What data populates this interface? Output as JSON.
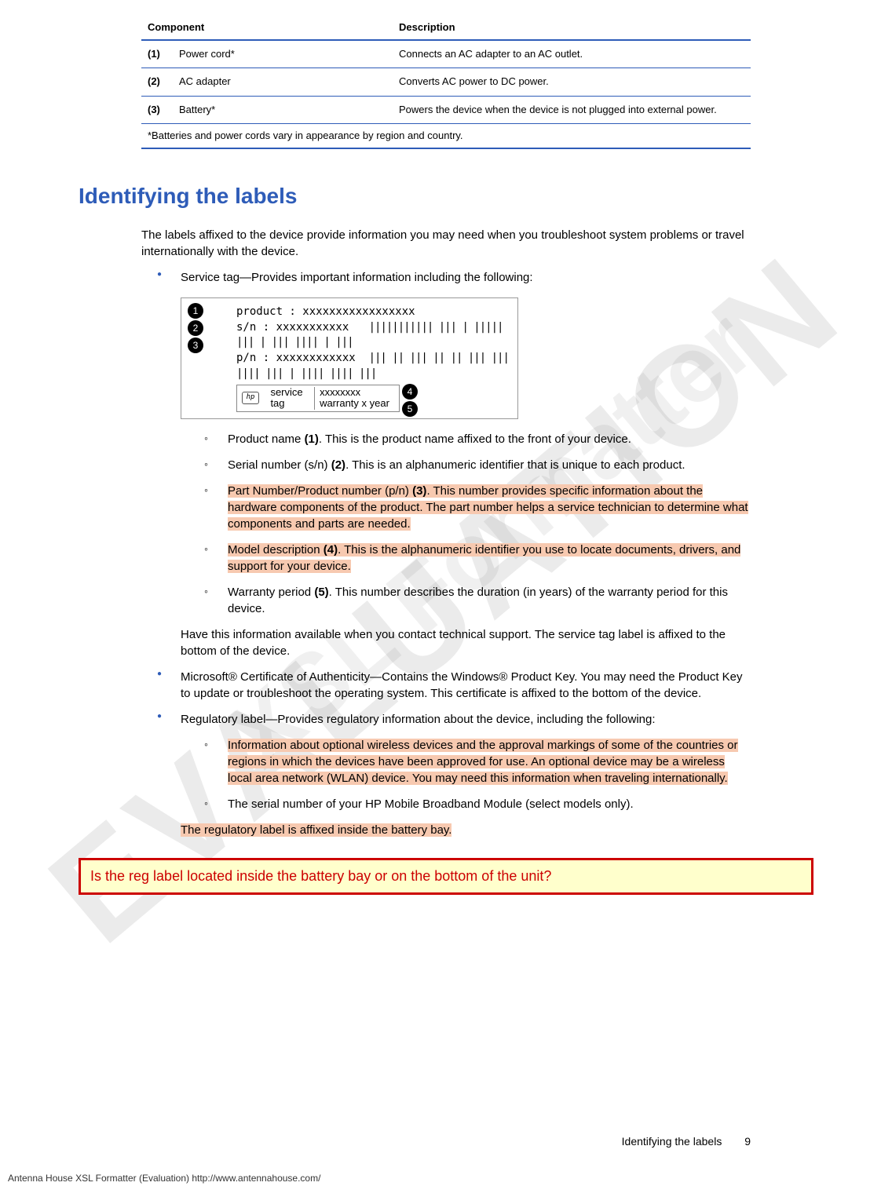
{
  "watermark1": "EVALUATION",
  "watermark2": "XSL Formatter",
  "table": {
    "headers": {
      "component": "Component",
      "description": "Description"
    },
    "rows": [
      {
        "num": "(1)",
        "name": "Power cord*",
        "desc": "Connects an AC adapter to an AC outlet."
      },
      {
        "num": "(2)",
        "name": "AC adapter",
        "desc": "Converts AC power to DC power."
      },
      {
        "num": "(3)",
        "name": "Battery*",
        "desc": "Powers the device when the device is not plugged into external power."
      }
    ],
    "footnote": "*Batteries and power cords vary in appearance by region and country."
  },
  "heading": "Identifying the labels",
  "intro": "The labels affixed to the device provide information you may need when you troubleshoot system problems or travel internationally with the device.",
  "bullets": {
    "service_tag": "Service tag—Provides important information including the following:",
    "diagram": {
      "product": "product : xxxxxxxxxxxxxxxxx",
      "sn": "s/n : xxxxxxxxxxx",
      "pn": "p/n : xxxxxxxxxxxx",
      "barcode1": "||||||||||| ||| | ||||| ||| | ||| |||| | |||",
      "barcode2": "||| || ||| || || ||| ||| |||| |||  | |||| |||| |||",
      "service_label": "service tag",
      "model": "xxxxxxxx",
      "warranty": "warranty  x year",
      "hp": "hp",
      "callouts": {
        "c1": "1",
        "c2": "2",
        "c3": "3",
        "c4": "4",
        "c5": "5"
      }
    },
    "sub": [
      {
        "pre": "Product name ",
        "bold": "(1)",
        "post": ". This is the product name affixed to the front of your device.",
        "hl": false
      },
      {
        "pre": "Serial number (s/n) ",
        "bold": "(2)",
        "post": ". This is an alphanumeric identifier that is unique to each product.",
        "hl": false
      },
      {
        "pre": "Part Number/Product number (p/n) ",
        "bold": "(3)",
        "post": ". This number provides specific information about the hardware components of the product. The part number helps a service technician to determine what components and parts are needed.",
        "hl": true
      },
      {
        "pre": "Model description ",
        "bold": "(4)",
        "post": ". This is the alphanumeric identifier you use to locate documents, drivers, and support for your device.",
        "hl": true
      },
      {
        "pre": "Warranty period ",
        "bold": "(5)",
        "post": ". This number describes the duration (in years) of the warranty period for this device.",
        "hl": false
      }
    ],
    "service_tag_note": "Have this information available when you contact technical support. The service tag label is affixed to the bottom of the device.",
    "coa": "Microsoft® Certificate of Authenticity—Contains the Windows® Product Key. You may need the Product Key to update or troubleshoot the operating system. This certificate is affixed to the bottom of the device.",
    "regulatory": "Regulatory label—Provides regulatory information about the device, including the following:",
    "reg_sub": [
      {
        "text": "Information about optional wireless devices and the approval markings of some of the countries or regions in which the devices have been approved for use. An optional device may be a wireless local area network (WLAN) device. You may need this information when traveling internationally.",
        "hl": true
      },
      {
        "text": "The serial number of your HP Mobile Broadband Module (select models only).",
        "hl": false
      }
    ],
    "reg_note": "The regulatory label is affixed inside the battery bay."
  },
  "review_comment": "Is the reg label located inside the battery bay or on the bottom of the unit?",
  "footer": {
    "title": "Identifying the labels",
    "page": "9"
  },
  "doc_footer": "Antenna House XSL Formatter (Evaluation)  http://www.antennahouse.com/"
}
